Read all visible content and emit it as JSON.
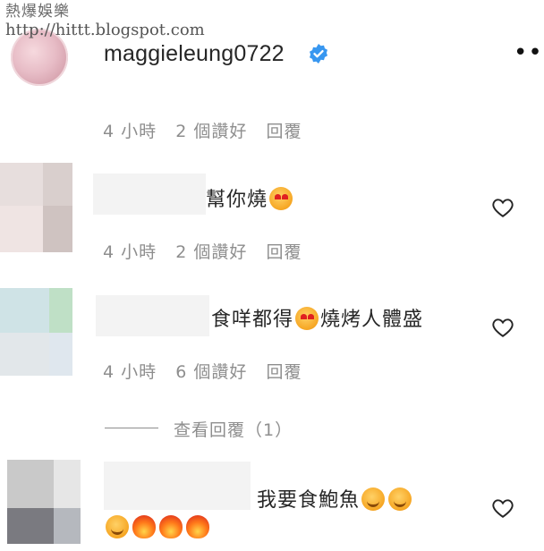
{
  "watermark": {
    "line1": "熱爆娛樂",
    "line2": "http://hittt.blogspot.com"
  },
  "header": {
    "username": "maggieleung0722",
    "more_label": "•••"
  },
  "comments": [
    {
      "meta": "4 小時   2 個讚好   回覆"
    },
    {
      "text": "幫你燒",
      "emojis": [
        "heart-eyes"
      ],
      "meta": "4 小時   2 個讚好   回覆"
    },
    {
      "text_a": "食咩都得",
      "text_b": "燒烤人體盛",
      "emojis": [
        "heart-eyes"
      ],
      "meta": "4 小時   6 個讚好   回覆"
    },
    {
      "view_replies": "查看回覆（1）"
    },
    {
      "text": "我要食鮑魚",
      "emojis": [
        "smiling-tongue",
        "smiling-tongue",
        "smiling-tongue",
        "fire",
        "fire",
        "fire"
      ]
    }
  ]
}
